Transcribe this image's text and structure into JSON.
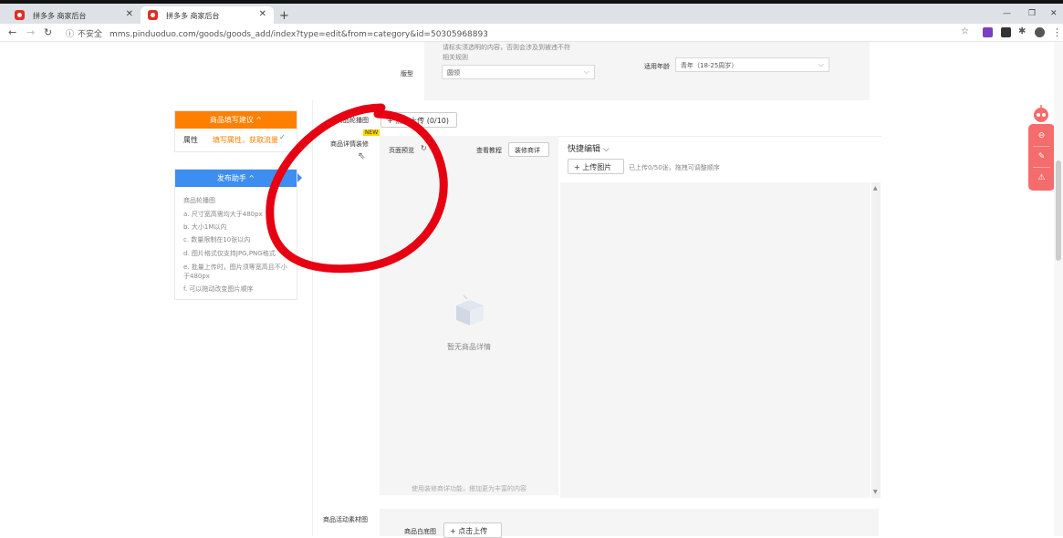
{
  "browser": {
    "tabs": [
      {
        "title": "拼多多 商家后台",
        "active": false
      },
      {
        "title": "拼多多 商家后台",
        "active": true
      }
    ],
    "insecure_label": "不安全",
    "url": "mms.pinduoduo.com/goods/goods_add/index?type=edit&from=category&id=50305968893"
  },
  "form_top": {
    "hint_line1": "请标实须选明的内容，否则会涉及到被违不符",
    "hint_line2": "相关规则",
    "pattern_label": "版型",
    "pattern_value": "圆领",
    "age_label": "适用年龄",
    "age_value": "青年（18-25周岁）"
  },
  "suggest_panel": {
    "title": "商品填写建议 ^",
    "attr_label": "属性",
    "attr_tip": "填写属性，获取流量",
    "check": "✓"
  },
  "assistant_panel": {
    "title": "发布助手 ^",
    "items": [
      "商品轮播图",
      "a. 尺寸宽高需均大于480px",
      "b. 大小1M以内",
      "c. 数量限制在10张以内",
      "d. 图片格式仅支持JPG,PNG格式",
      "e. 批量上传时，图片须等宽高且不小于480px",
      "f. 可以拖动改变图片顺序"
    ]
  },
  "carousel": {
    "label": "商品轮播图",
    "upload_button": "+ 点击上传 (0/10)"
  },
  "detail": {
    "label": "商品详情装修",
    "new_badge": "NEW",
    "preview_label": "页面预览",
    "tutorial_link": "查看教程",
    "decorate_button": "装修商详",
    "empty_text": "暂无商品详情",
    "footer_hint": "使用装修商详功能，搭加更为丰富的内容"
  },
  "quick_edit": {
    "title": "快捷编辑",
    "upload_button": "+ 上传图片",
    "upload_hint": "已上传0/50张，拖拽可调整顺序"
  },
  "activity": {
    "label": "商品活动素材图",
    "white_bg_label": "商品白底图",
    "upload_button": "+ 点击上传"
  },
  "icons": {
    "float_bar": [
      "headset-icon",
      "edit-icon",
      "warning-icon"
    ]
  },
  "colors": {
    "brand_red": "#e02e24",
    "orange": "#ff7f00",
    "blue": "#3d8ef0",
    "annotation_red": "#e60012"
  }
}
